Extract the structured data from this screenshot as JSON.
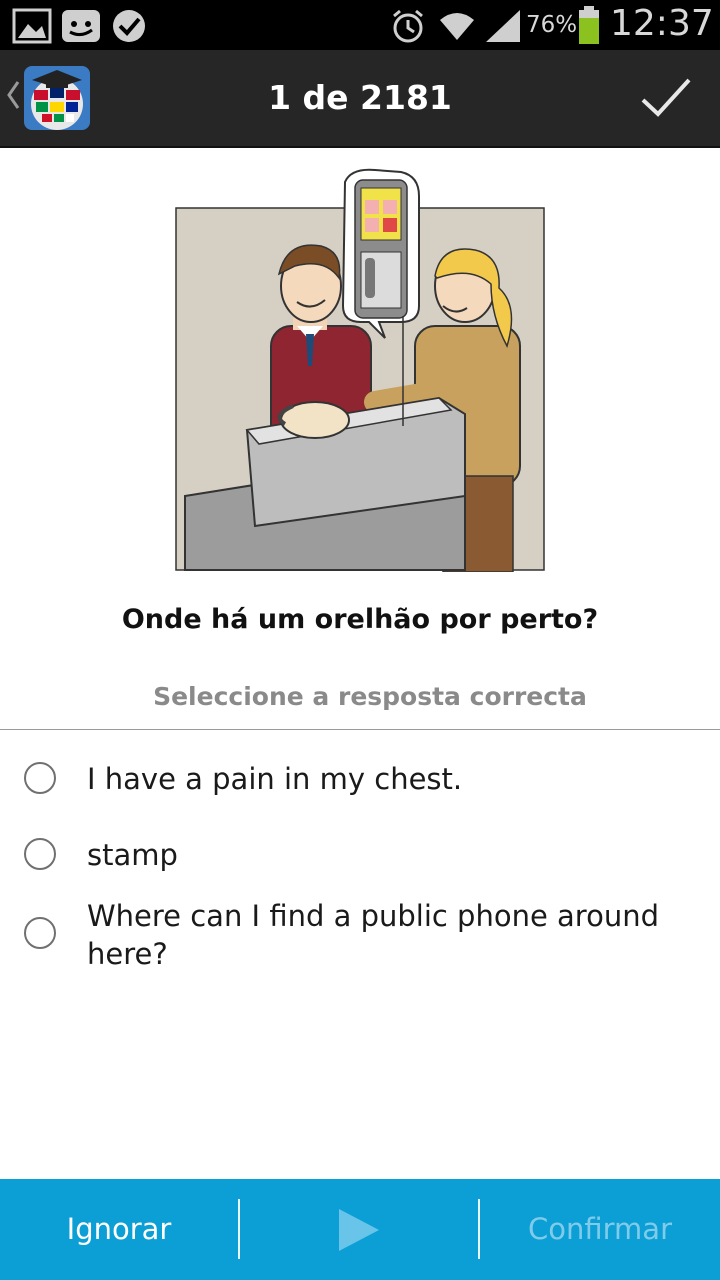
{
  "status_bar": {
    "battery_percent": "76%",
    "time": "12:37",
    "icons": [
      "gallery-icon",
      "messenger-icon",
      "check-badge-icon",
      "alarm-icon",
      "wifi-icon",
      "signal-icon",
      "battery-icon"
    ]
  },
  "header": {
    "title": "1 de 2181",
    "confirm_icon": "checkmark-icon"
  },
  "question": {
    "text": "Onde há um orelhão por perto?",
    "instruction": "Seleccione a resposta correcta"
  },
  "options": [
    {
      "label": "I have a pain in my chest.",
      "selected": false
    },
    {
      "label": "stamp",
      "selected": false
    },
    {
      "label": "Where can I find a public phone around here?",
      "selected": false
    }
  ],
  "bottom_bar": {
    "skip_label": "Ignorar",
    "play_icon": "play-icon",
    "confirm_label": "Confirmar"
  },
  "colors": {
    "action_bar": "#262626",
    "bottom_bar": "#0b9fd6",
    "disabled_text": "#7fcbe9"
  }
}
